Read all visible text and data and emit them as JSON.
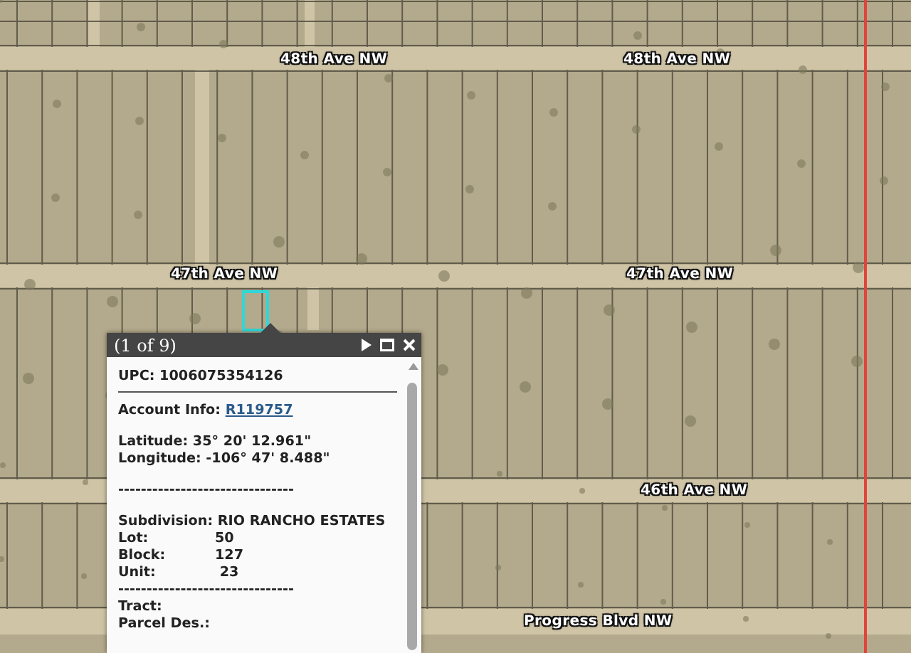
{
  "map": {
    "street_labels": [
      {
        "text": "48th Ave NW"
      },
      {
        "text": "48th Ave NW"
      },
      {
        "text": "47th Ave NW"
      },
      {
        "text": "47th Ave NW"
      },
      {
        "text": "46th Ave NW"
      },
      {
        "text": "Progress Blvd NW"
      }
    ]
  },
  "popup": {
    "title": "(1 of 9)",
    "lines": [
      {
        "kind": "text",
        "text": "UPC: 1006075354126"
      },
      {
        "kind": "rule"
      },
      {
        "kind": "link",
        "label": "Account Info:",
        "link": "R119757"
      },
      {
        "kind": "gap"
      },
      {
        "kind": "text",
        "text": "Latitude: 35° 20' 12.961\""
      },
      {
        "kind": "text",
        "text": "Longitude: -106° 47' 8.488\""
      },
      {
        "kind": "gap"
      },
      {
        "kind": "text",
        "text": "-------------------------------"
      },
      {
        "kind": "gap"
      },
      {
        "kind": "text",
        "text": "Subdivision: RIO RANCHO ESTATES"
      },
      {
        "kind": "pair",
        "label": "Lot:",
        "value": "50"
      },
      {
        "kind": "pair",
        "label": "Block:",
        "value": "127"
      },
      {
        "kind": "pair",
        "label": "Unit:",
        "value": " 23"
      },
      {
        "kind": "text",
        "text": "-------------------------------"
      },
      {
        "kind": "text",
        "text": "Tract:"
      },
      {
        "kind": "text",
        "text": "Parcel Des.:"
      }
    ]
  }
}
